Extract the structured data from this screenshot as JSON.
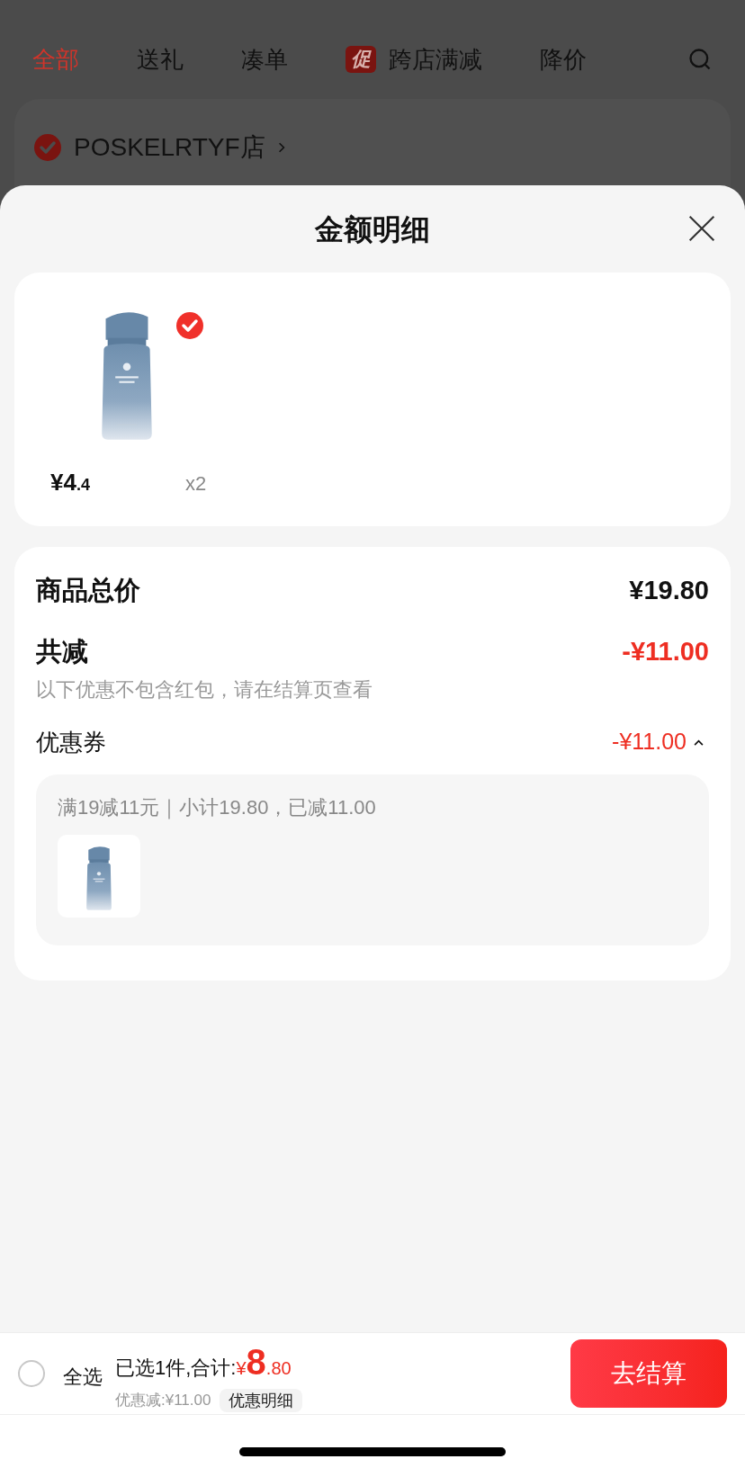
{
  "background": {
    "tabs": [
      {
        "label": "全部",
        "selected": true
      },
      {
        "label": "送礼",
        "selected": false
      },
      {
        "label": "凑单",
        "selected": false
      },
      {
        "label": "跨店满减",
        "badge": "促",
        "selected": false
      },
      {
        "label": "降价",
        "selected": false
      }
    ],
    "store": {
      "name": "POSKELRTYF店",
      "checked": true
    }
  },
  "sheet": {
    "title": "金额明细",
    "items": [
      {
        "kind": "picture",
        "checked": true,
        "price_main": "¥4",
        "price_decimal": ".4",
        "quantity": "x2"
      }
    ],
    "summary": {
      "total_label": "商品总价",
      "total_value": "¥19.80",
      "discount_label": "共减",
      "discount_value": "-¥11.00",
      "note": "以下优惠不包含红包，请在结算页查看",
      "coupon": {
        "label": "优惠券",
        "value": "-¥11.00",
        "expanded": true,
        "detail": "满19减11元｜小计19.80，已减11.00"
      }
    }
  },
  "bottom_bar": {
    "select_all": {
      "label": "全选",
      "checked": false
    },
    "summary": "已选1件,合计:",
    "currency": "¥",
    "total_integer": "8",
    "total_decimal": ".80",
    "discount": "优惠减:¥11.00",
    "detail_button": "优惠明细",
    "checkout": "去结算"
  }
}
